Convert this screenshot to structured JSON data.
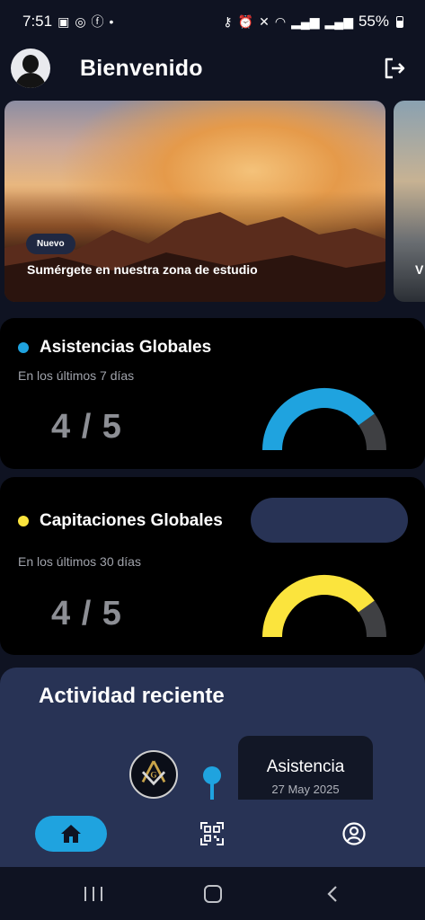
{
  "status_bar": {
    "time": "7:51",
    "dot": "•",
    "battery": "55%",
    "left_icons": [
      "gallery-icon",
      "whatsapp-icon",
      "facebook-icon"
    ],
    "right_icons": [
      "key-icon",
      "alarm-icon",
      "mute-icon",
      "wifi-icon",
      "signal-icon",
      "signal-icon",
      "battery-icon"
    ]
  },
  "header": {
    "title": "Bienvenido",
    "avatar_icon": "user-avatar-icon",
    "logout_icon": "logout-icon"
  },
  "carousel": {
    "slides": [
      {
        "badge": "Nuevo",
        "title": "Sumérgete en nuestra zona de estudio"
      },
      {
        "title": "V"
      }
    ]
  },
  "cards": [
    {
      "title": "Asistencias Globales",
      "subtitle": "En los últimos 7 días",
      "value_text": "4 / 5",
      "current": 4,
      "total": 5,
      "color": "#1fa3df"
    },
    {
      "title": "Capitaciones Globales",
      "subtitle": "En los últimos 30 días",
      "value_text": "4 / 5",
      "current": 4,
      "total": 5,
      "color": "#fbe43d"
    }
  ],
  "activity": {
    "title": "Actividad reciente",
    "items": [
      {
        "label": "Asistencia",
        "date": "27 May 2025",
        "icon": "masonic-emblem-icon"
      }
    ],
    "accent": "#1fa3df"
  },
  "bottom_nav": {
    "items": [
      {
        "icon": "home-icon",
        "active": true
      },
      {
        "icon": "qr-code-icon",
        "active": false
      },
      {
        "icon": "profile-icon",
        "active": false
      }
    ],
    "accent": "#1fa3df"
  },
  "colors": {
    "background": "#0f1322",
    "card": "#000000",
    "panel": "#283355",
    "gauge_track": "#3f4043"
  }
}
